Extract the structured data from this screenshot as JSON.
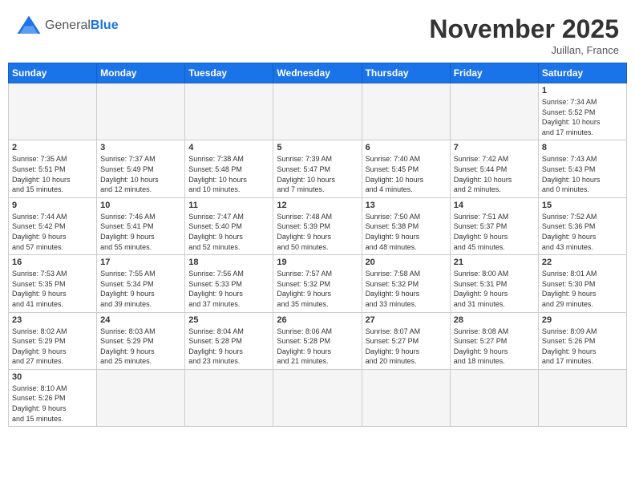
{
  "header": {
    "logo_general": "General",
    "logo_blue": "Blue",
    "month_title": "November 2025",
    "subtitle": "Juillan, France"
  },
  "weekdays": [
    "Sunday",
    "Monday",
    "Tuesday",
    "Wednesday",
    "Thursday",
    "Friday",
    "Saturday"
  ],
  "weeks": [
    [
      {
        "day": "",
        "info": ""
      },
      {
        "day": "",
        "info": ""
      },
      {
        "day": "",
        "info": ""
      },
      {
        "day": "",
        "info": ""
      },
      {
        "day": "",
        "info": ""
      },
      {
        "day": "",
        "info": ""
      },
      {
        "day": "1",
        "info": "Sunrise: 7:34 AM\nSunset: 5:52 PM\nDaylight: 10 hours\nand 17 minutes."
      }
    ],
    [
      {
        "day": "2",
        "info": "Sunrise: 7:35 AM\nSunset: 5:51 PM\nDaylight: 10 hours\nand 15 minutes."
      },
      {
        "day": "3",
        "info": "Sunrise: 7:37 AM\nSunset: 5:49 PM\nDaylight: 10 hours\nand 12 minutes."
      },
      {
        "day": "4",
        "info": "Sunrise: 7:38 AM\nSunset: 5:48 PM\nDaylight: 10 hours\nand 10 minutes."
      },
      {
        "day": "5",
        "info": "Sunrise: 7:39 AM\nSunset: 5:47 PM\nDaylight: 10 hours\nand 7 minutes."
      },
      {
        "day": "6",
        "info": "Sunrise: 7:40 AM\nSunset: 5:45 PM\nDaylight: 10 hours\nand 4 minutes."
      },
      {
        "day": "7",
        "info": "Sunrise: 7:42 AM\nSunset: 5:44 PM\nDaylight: 10 hours\nand 2 minutes."
      },
      {
        "day": "8",
        "info": "Sunrise: 7:43 AM\nSunset: 5:43 PM\nDaylight: 10 hours\nand 0 minutes."
      }
    ],
    [
      {
        "day": "9",
        "info": "Sunrise: 7:44 AM\nSunset: 5:42 PM\nDaylight: 9 hours\nand 57 minutes."
      },
      {
        "day": "10",
        "info": "Sunrise: 7:46 AM\nSunset: 5:41 PM\nDaylight: 9 hours\nand 55 minutes."
      },
      {
        "day": "11",
        "info": "Sunrise: 7:47 AM\nSunset: 5:40 PM\nDaylight: 9 hours\nand 52 minutes."
      },
      {
        "day": "12",
        "info": "Sunrise: 7:48 AM\nSunset: 5:39 PM\nDaylight: 9 hours\nand 50 minutes."
      },
      {
        "day": "13",
        "info": "Sunrise: 7:50 AM\nSunset: 5:38 PM\nDaylight: 9 hours\nand 48 minutes."
      },
      {
        "day": "14",
        "info": "Sunrise: 7:51 AM\nSunset: 5:37 PM\nDaylight: 9 hours\nand 45 minutes."
      },
      {
        "day": "15",
        "info": "Sunrise: 7:52 AM\nSunset: 5:36 PM\nDaylight: 9 hours\nand 43 minutes."
      }
    ],
    [
      {
        "day": "16",
        "info": "Sunrise: 7:53 AM\nSunset: 5:35 PM\nDaylight: 9 hours\nand 41 minutes."
      },
      {
        "day": "17",
        "info": "Sunrise: 7:55 AM\nSunset: 5:34 PM\nDaylight: 9 hours\nand 39 minutes."
      },
      {
        "day": "18",
        "info": "Sunrise: 7:56 AM\nSunset: 5:33 PM\nDaylight: 9 hours\nand 37 minutes."
      },
      {
        "day": "19",
        "info": "Sunrise: 7:57 AM\nSunset: 5:32 PM\nDaylight: 9 hours\nand 35 minutes."
      },
      {
        "day": "20",
        "info": "Sunrise: 7:58 AM\nSunset: 5:32 PM\nDaylight: 9 hours\nand 33 minutes."
      },
      {
        "day": "21",
        "info": "Sunrise: 8:00 AM\nSunset: 5:31 PM\nDaylight: 9 hours\nand 31 minutes."
      },
      {
        "day": "22",
        "info": "Sunrise: 8:01 AM\nSunset: 5:30 PM\nDaylight: 9 hours\nand 29 minutes."
      }
    ],
    [
      {
        "day": "23",
        "info": "Sunrise: 8:02 AM\nSunset: 5:29 PM\nDaylight: 9 hours\nand 27 minutes."
      },
      {
        "day": "24",
        "info": "Sunrise: 8:03 AM\nSunset: 5:29 PM\nDaylight: 9 hours\nand 25 minutes."
      },
      {
        "day": "25",
        "info": "Sunrise: 8:04 AM\nSunset: 5:28 PM\nDaylight: 9 hours\nand 23 minutes."
      },
      {
        "day": "26",
        "info": "Sunrise: 8:06 AM\nSunset: 5:28 PM\nDaylight: 9 hours\nand 21 minutes."
      },
      {
        "day": "27",
        "info": "Sunrise: 8:07 AM\nSunset: 5:27 PM\nDaylight: 9 hours\nand 20 minutes."
      },
      {
        "day": "28",
        "info": "Sunrise: 8:08 AM\nSunset: 5:27 PM\nDaylight: 9 hours\nand 18 minutes."
      },
      {
        "day": "29",
        "info": "Sunrise: 8:09 AM\nSunset: 5:26 PM\nDaylight: 9 hours\nand 17 minutes."
      }
    ],
    [
      {
        "day": "30",
        "info": "Sunrise: 8:10 AM\nSunset: 5:26 PM\nDaylight: 9 hours\nand 15 minutes."
      },
      {
        "day": "",
        "info": ""
      },
      {
        "day": "",
        "info": ""
      },
      {
        "day": "",
        "info": ""
      },
      {
        "day": "",
        "info": ""
      },
      {
        "day": "",
        "info": ""
      },
      {
        "day": "",
        "info": ""
      }
    ]
  ]
}
